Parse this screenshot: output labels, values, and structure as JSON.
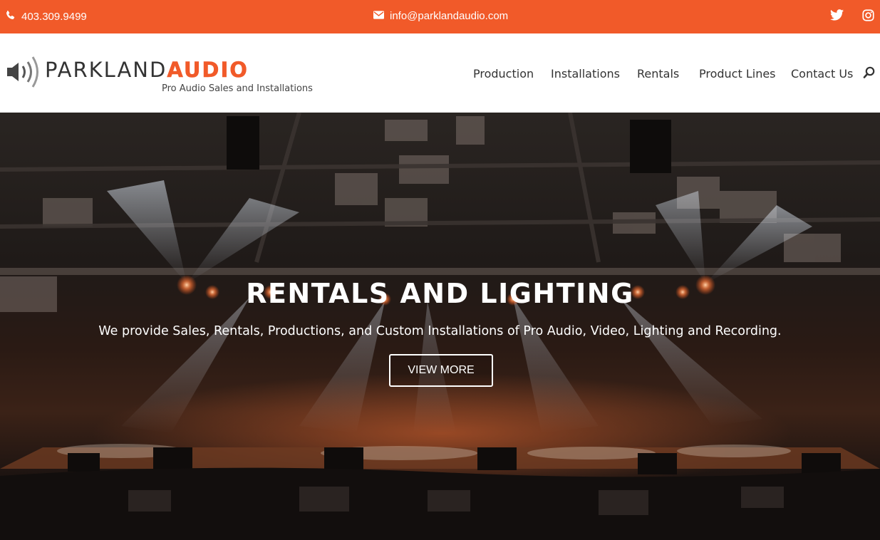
{
  "topbar": {
    "phone": "403.309.9499",
    "email": "info@parklandaudio.com",
    "social_icons": [
      "twitter-icon",
      "instagram-icon"
    ],
    "background_color": "#f15a29"
  },
  "logo": {
    "word_primary": "PARKLAND",
    "word_accent": "AUDIO",
    "tagline": "Pro Audio Sales and Installations",
    "icon": "speaker-icon",
    "accent_color": "#f15a29"
  },
  "nav": {
    "items": [
      {
        "label": "Production"
      },
      {
        "label": "Installations"
      },
      {
        "label": "Rentals"
      },
      {
        "label": "Product Lines"
      },
      {
        "label": "Contact Us"
      }
    ],
    "search_icon": "search-icon"
  },
  "hero": {
    "title": "RENTALS AND LIGHTING",
    "subtitle": "We provide Sales, Rentals, Productions, and Custom Installations of Pro Audio, Video, Lighting and Recording.",
    "button_label": "VIEW MORE"
  }
}
